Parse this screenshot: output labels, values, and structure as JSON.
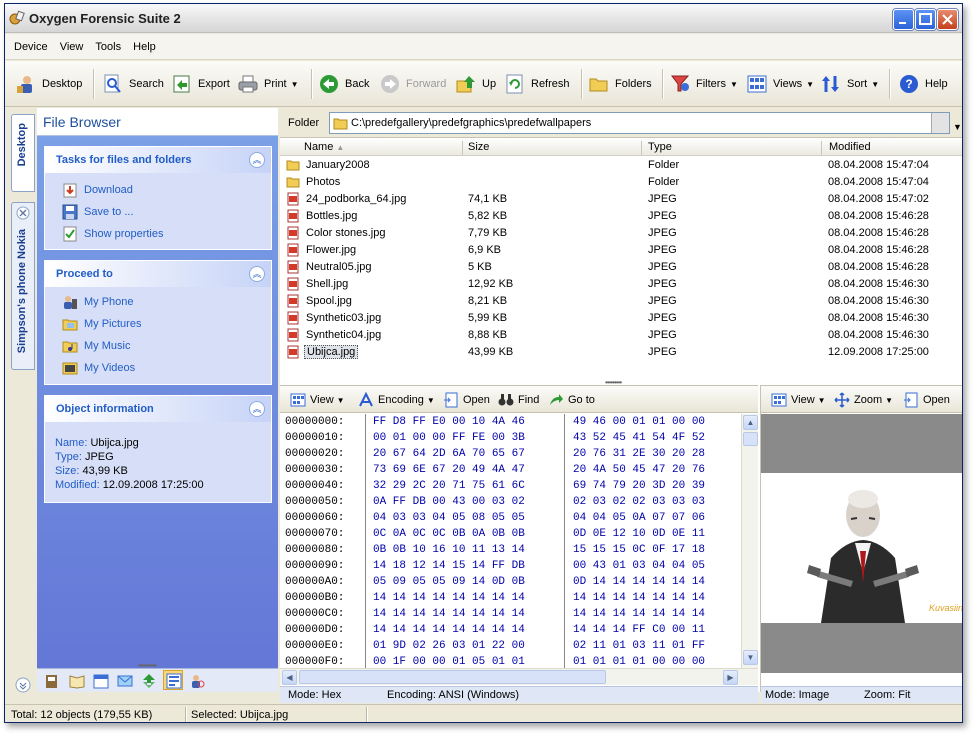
{
  "window": {
    "title": "Oxygen Forensic Suite 2"
  },
  "menu": [
    "Device",
    "View",
    "Tools",
    "Help"
  ],
  "toolbar": {
    "desktop": "Desktop",
    "search": "Search",
    "export": "Export",
    "print": "Print",
    "back": "Back",
    "forward": "Forward",
    "up": "Up",
    "refresh": "Refresh",
    "folders": "Folders",
    "filters": "Filters",
    "views": "Views",
    "sort": "Sort",
    "help": "Help"
  },
  "sidetabs": {
    "desktop": "Desktop",
    "phone": "Simpson's phone Nokia"
  },
  "left": {
    "title": "File Browser",
    "tasks": {
      "title": "Tasks for files and folders",
      "items": [
        "Download",
        "Save to ...",
        "Show properties"
      ]
    },
    "proceed": {
      "title": "Proceed to",
      "items": [
        "My Phone",
        "My Pictures",
        "My Music",
        "My Videos"
      ]
    },
    "objinfo": {
      "title": "Object information",
      "name_k": "Name:",
      "name_v": "Ubijca.jpg",
      "type_k": "Type:",
      "type_v": "JPEG",
      "size_k": "Size:",
      "size_v": "43,99 KB",
      "mod_k": "Modified:",
      "mod_v": "12.09.2008 17:25:00"
    }
  },
  "folder": {
    "label": "Folder",
    "path": "C:\\predefgallery\\predefgraphics\\predefwallpapers"
  },
  "columns": {
    "name": "Name",
    "size": "Size",
    "type": "Type",
    "modified": "Modified"
  },
  "files": [
    {
      "name": "January2008",
      "size": "",
      "type": "Folder",
      "modified": "08.04.2008 15:47:04",
      "kind": "folder"
    },
    {
      "name": "Photos",
      "size": "",
      "type": "Folder",
      "modified": "08.04.2008 15:47:04",
      "kind": "folder"
    },
    {
      "name": "24_podborka_64.jpg",
      "size": "74,1 KB",
      "type": "JPEG",
      "modified": "08.04.2008 15:47:02",
      "kind": "jpeg"
    },
    {
      "name": "Bottles.jpg",
      "size": "5,82 KB",
      "type": "JPEG",
      "modified": "08.04.2008 15:46:28",
      "kind": "jpeg"
    },
    {
      "name": "Color stones.jpg",
      "size": "7,79 KB",
      "type": "JPEG",
      "modified": "08.04.2008 15:46:28",
      "kind": "jpeg"
    },
    {
      "name": "Flower.jpg",
      "size": "6,9 KB",
      "type": "JPEG",
      "modified": "08.04.2008 15:46:28",
      "kind": "jpeg"
    },
    {
      "name": "Neutral05.jpg",
      "size": "5 KB",
      "type": "JPEG",
      "modified": "08.04.2008 15:46:28",
      "kind": "jpeg"
    },
    {
      "name": "Shell.jpg",
      "size": "12,92 KB",
      "type": "JPEG",
      "modified": "08.04.2008 15:46:30",
      "kind": "jpeg"
    },
    {
      "name": "Spool.jpg",
      "size": "8,21 KB",
      "type": "JPEG",
      "modified": "08.04.2008 15:46:30",
      "kind": "jpeg"
    },
    {
      "name": "Synthetic03.jpg",
      "size": "5,99 KB",
      "type": "JPEG",
      "modified": "08.04.2008 15:46:30",
      "kind": "jpeg"
    },
    {
      "name": "Synthetic04.jpg",
      "size": "8,88 KB",
      "type": "JPEG",
      "modified": "08.04.2008 15:46:30",
      "kind": "jpeg"
    },
    {
      "name": "Ubijca.jpg",
      "size": "43,99 KB",
      "type": "JPEG",
      "modified": "12.09.2008 17:25:00",
      "kind": "jpeg",
      "selected": true
    }
  ],
  "hexToolbar": {
    "view": "View",
    "encoding": "Encoding",
    "open": "Open",
    "find": "Find",
    "goto": "Go to"
  },
  "hex": [
    {
      "off": "00000000:",
      "a": "FF D8 FF E0 00 10 4A 46",
      "b": "49 46 00 01 01 00 00"
    },
    {
      "off": "00000010:",
      "a": "00 01 00 00 FF FE 00 3B",
      "b": "43 52 45 41 54 4F 52"
    },
    {
      "off": "00000020:",
      "a": "20 67 64 2D 6A 70 65 67",
      "b": "20 76 31 2E 30 20 28"
    },
    {
      "off": "00000030:",
      "a": "73 69 6E 67 20 49 4A 47",
      "b": "20 4A 50 45 47 20 76"
    },
    {
      "off": "00000040:",
      "a": "32 29 2C 20 71 75 61 6C",
      "b": "69 74 79 20 3D 20 39"
    },
    {
      "off": "00000050:",
      "a": "0A FF DB 00 43 00 03 02",
      "b": "02 03 02 02 03 03 03"
    },
    {
      "off": "00000060:",
      "a": "04 03 03 04 05 08 05 05",
      "b": "04 04 05 0A 07 07 06"
    },
    {
      "off": "00000070:",
      "a": "0C 0A 0C 0C 0B 0A 0B 0B",
      "b": "0D 0E 12 10 0D 0E 11"
    },
    {
      "off": "00000080:",
      "a": "0B 0B 10 16 10 11 13 14",
      "b": "15 15 15 0C 0F 17 18"
    },
    {
      "off": "00000090:",
      "a": "14 18 12 14 15 14 FF DB",
      "b": "00 43 01 03 04 04 05"
    },
    {
      "off": "000000A0:",
      "a": "05 09 05 05 09 14 0D 0B",
      "b": "0D 14 14 14 14 14 14"
    },
    {
      "off": "000000B0:",
      "a": "14 14 14 14 14 14 14 14",
      "b": "14 14 14 14 14 14 14"
    },
    {
      "off": "000000C0:",
      "a": "14 14 14 14 14 14 14 14",
      "b": "14 14 14 14 14 14 14"
    },
    {
      "off": "000000D0:",
      "a": "14 14 14 14 14 14 14 14",
      "b": "14 14 14 FF C0 00 11"
    },
    {
      "off": "000000E0:",
      "a": "01 9D 02 26 03 01 22 00",
      "b": "02 11 01 03 11 01 FF"
    },
    {
      "off": "000000F0:",
      "a": "00 1F 00 00 01 05 01 01",
      "b": "01 01 01 01 00 00 00"
    }
  ],
  "hexStatus": {
    "mode": "Mode: Hex",
    "encoding": "Encoding: ANSI (Windows)"
  },
  "imgToolbar": {
    "view": "View",
    "zoom": "Zoom",
    "open": "Open"
  },
  "imgStatus": {
    "mode": "Mode: Image",
    "zoom": "Zoom: Fit"
  },
  "imgWatermark": "Kuvasiin",
  "statusbar": {
    "total": "Total: 12 objects (179,55 KB)",
    "selected": "Selected:  Ubijca.jpg"
  },
  "colors": {
    "link": "#215dc6",
    "leftBg": "#6f8fe0",
    "selection": "#316ac5"
  }
}
